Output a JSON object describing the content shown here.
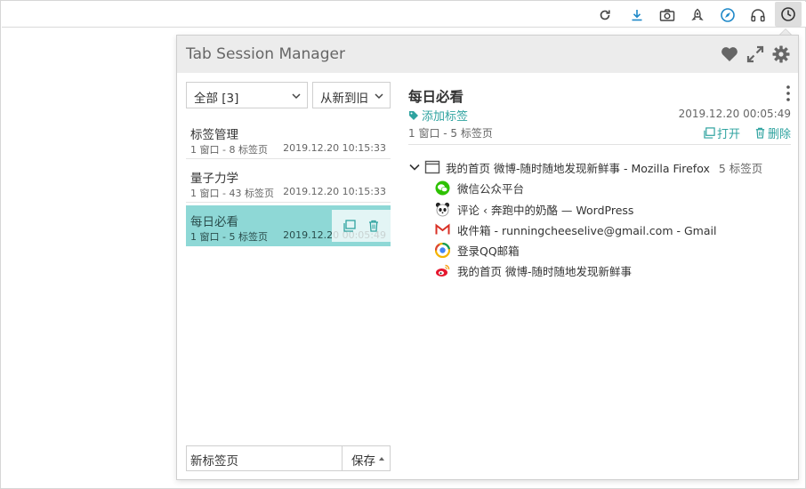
{
  "app": {
    "title": "Tab Session Manager"
  },
  "toolbar": {
    "icons": [
      "reload-icon",
      "download-icon",
      "camera-icon",
      "rocket-icon",
      "compass-icon",
      "headphones-icon",
      "clock-icon"
    ]
  },
  "filters": {
    "tag_selected": "全部 [3]",
    "sort_selected": "从新到旧"
  },
  "sessions": [
    {
      "name": "标签管理",
      "meta": "1 窗口 - 8 标签页",
      "date": "2019.12.20 10:15:33"
    },
    {
      "name": "量子力学",
      "meta": "1 窗口 - 43 标签页",
      "date": "2019.12.20 10:15:33"
    },
    {
      "name": "每日必看",
      "meta": "1 窗口 - 5 标签页",
      "date": "2019.12.20 00:05:49"
    }
  ],
  "footer": {
    "name_value": "新标签页",
    "save_label": "保存"
  },
  "detail": {
    "title": "每日必看",
    "add_tag_label": "添加标签",
    "date": "2019.12.20 00:05:49",
    "meta": "1 窗口 - 5 标签页",
    "open_label": "打开",
    "delete_label": "删除",
    "window_title": "我的首页 微博-随时随地发现新鲜事 - Mozilla Firefox",
    "window_count": "5 标签页",
    "tabs": [
      {
        "title": "微信公众平台",
        "icon": "wechat-icon"
      },
      {
        "title": "评论 ‹ 奔跑中的奶酪 — WordPress",
        "icon": "panda-icon"
      },
      {
        "title": "收件箱 - runningcheeselive@gmail.com - Gmail",
        "icon": "gmail-icon"
      },
      {
        "title": "登录QQ邮箱",
        "icon": "qq-icon"
      },
      {
        "title": "我的首页 微博-随时随地发现新鲜事",
        "icon": "weibo-icon"
      }
    ]
  },
  "colors": {
    "accent": "#2fa3a0",
    "selected_bg": "#8ed8d6",
    "header_bg": "#ececec"
  }
}
